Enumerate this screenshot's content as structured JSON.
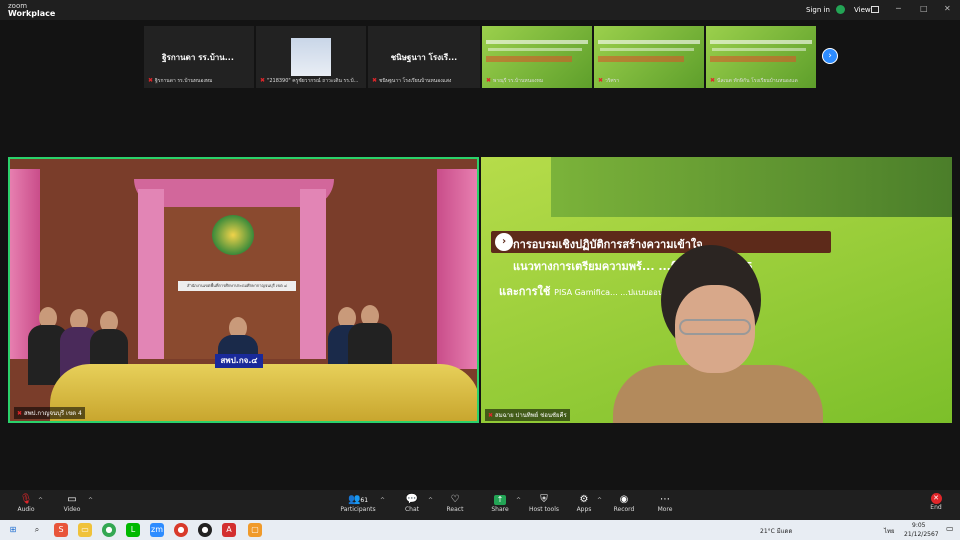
{
  "app": {
    "brand_top": "zoom",
    "brand_bottom": "Workplace"
  },
  "header": {
    "sign_in": "Sign in",
    "view": "View"
  },
  "strip": {
    "tiles": [
      {
        "big": "ฐิรกานดา รร.บ้าน...",
        "name": "ฐิรกานดา รร.บ้านหนองหม"
      },
      {
        "big": "",
        "name": "\"218390\" ครูชัยวากรณ์ ถาวะเดิน รร.บ้..."
      },
      {
        "big": "ชนิษฐนาา โรงเรี...",
        "name": "ชนิษฐนาา โรงเรียนบ้านหนองแสง"
      },
      {
        "name": "พาณุรี รร.บ้านหนองหม"
      },
      {
        "name": "วริศรา"
      },
      {
        "name": "นีลเนต ทักษิกัน โรงเรียนบ้านหนองแด"
      }
    ],
    "next_icon": "›"
  },
  "left_video": {
    "label": "สพป.กาญจนบุรี เขต 4",
    "placard": "สพป.กจ.๔",
    "signboard": "สำนักงานเขตพื้นที่การศึกษาประถมศึกษากาญจนบุรี เขต ๔"
  },
  "right_video": {
    "label": "สมฉาย ปานทิพย์ ช่อนชัยคีร",
    "slide_title": "การอบรมเชิงปฏิบัติการสร้างความเข้าใจ",
    "slide_line2": "แนวทางการเตรียมความพร้...     ...นิน PISA 2025",
    "slide_line3_a": "และการใช้",
    "slide_line3_b": "PISA Gamifica...                       ...ปแบบออนไลน์",
    "arrow": "›"
  },
  "toolbar": {
    "audio": "Audio",
    "video": "Video",
    "participants": "Participants",
    "participants_count": "61",
    "chat": "Chat",
    "react": "React",
    "share": "Share",
    "host_tools": "Host tools",
    "apps": "Apps",
    "record": "Record",
    "more": "More",
    "end": "End"
  },
  "taskbar": {
    "weather": "21°C มีแดด",
    "time": "9:05",
    "date": "21/12/2567",
    "lang": "ไทย"
  },
  "colors": {
    "active_speaker": "#2bd26b",
    "end": "#e0262a",
    "share": "#23a455"
  }
}
